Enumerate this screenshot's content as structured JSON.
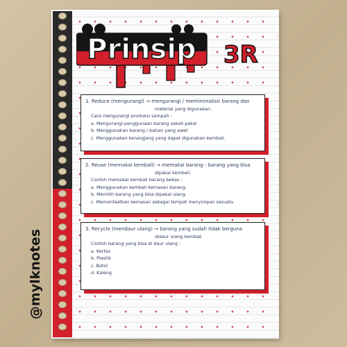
{
  "watermark": "@mylknotes",
  "title": {
    "word1": "Prinsip",
    "word2": "3R"
  },
  "sections": [
    {
      "heading": "1. Reduce  (mengurangi)   →  mengurangi / meminimalisir barang dan",
      "heading_cont": "material yang digunakan.",
      "intro": "Cara mengurangi produksi sampah :",
      "items": [
        "a. Mengurangi penggunaan barang sekali pakai",
        "b. Menggunakan barang / bahan yang awet",
        "c. Menggunakan kerangjang yang dapat digunakan kembali."
      ]
    },
    {
      "heading": "2. Reuse  (memakai kembali)   →  memakai barang - barang yang bisa",
      "heading_cont": "dipakai kembali.",
      "intro": "Contoh memakai kembali barang bekas :",
      "items": [
        "a. Menggunakan kembali kemasan barang.",
        "b. Memilih barang yang bisa dipakai ulang.",
        "c. Memanfaatkan kemasan sebagai tempat menyimpan sesuatu"
      ]
    },
    {
      "heading": "3. Recycle  (mendaur ulang)   →  barang yang sudah tidak berguna",
      "heading_cont": "didaur ulang kembali",
      "intro": "Contoh barang yang bisa di daur ulang :",
      "items": [
        "a. Kertas",
        "b. Plastik",
        "c. Botol",
        "d. Kaleng"
      ]
    }
  ],
  "colors": {
    "accent_red": "#d1202b",
    "ink_black": "#151515",
    "ink_blue": "#2a3a5c",
    "paper": "#fbfbfb"
  }
}
